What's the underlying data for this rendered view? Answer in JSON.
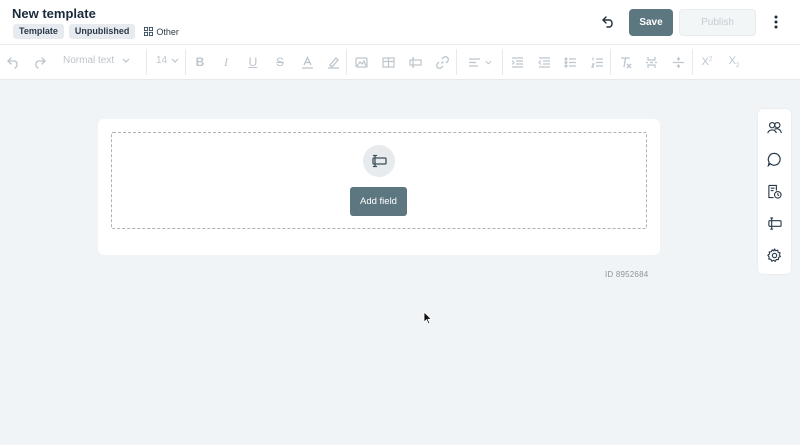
{
  "header": {
    "title": "New template",
    "tags": [
      "Template",
      "Unpublished"
    ],
    "category": "Other",
    "save_label": "Save",
    "publish_label": "Publish"
  },
  "toolbar": {
    "text_style": "Normal text",
    "font_size": "14"
  },
  "editor": {
    "add_field_label": "Add field"
  },
  "document": {
    "id_label": "ID 8952684"
  },
  "colors": {
    "accent": "#5d7781",
    "background": "#f1f4f6",
    "disabled": "#bcc5cc"
  }
}
